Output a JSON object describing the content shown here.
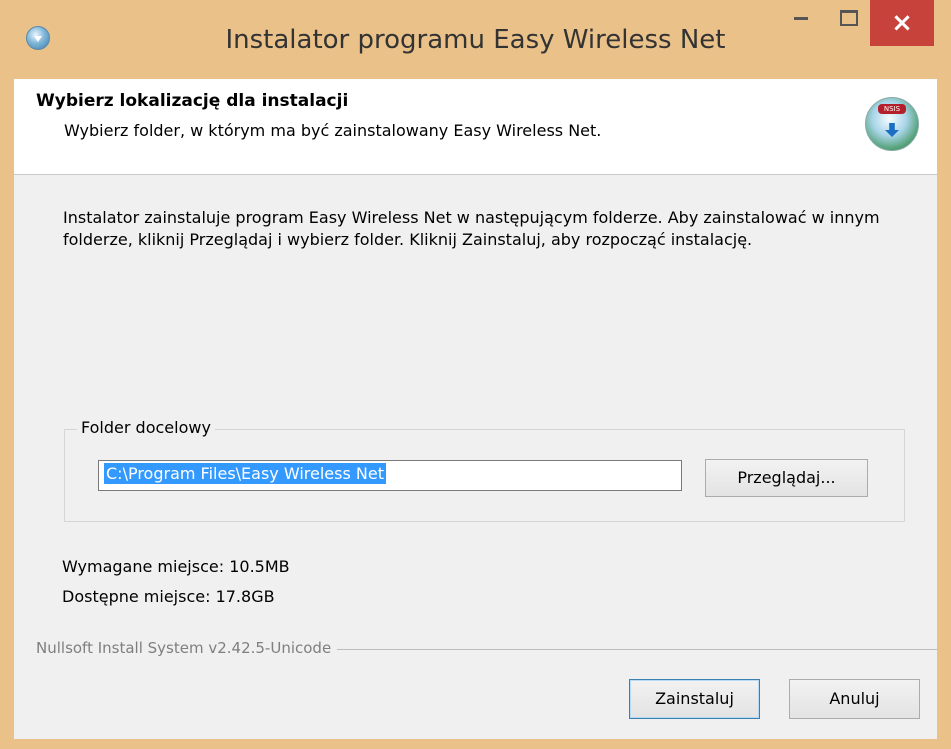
{
  "window": {
    "title": "Instalator programu Easy Wireless Net",
    "close_label": "×"
  },
  "header": {
    "title": "Wybierz lokalizację dla instalacji",
    "subtitle": "Wybierz folder, w którym ma być zainstalowany Easy Wireless Net.",
    "icon_badge": "NSIS"
  },
  "main": {
    "description": "Instalator zainstaluje program Easy Wireless Net w następującym folderze. Aby zainstalować w innym folderze, kliknij Przeglądaj i wybierz folder. Kliknij Zainstaluj, aby rozpocząć instalację.",
    "destination": {
      "group_label": "Folder docelowy",
      "path_value": "C:\\Program Files\\Easy Wireless Net",
      "browse_label": "Przeglądaj..."
    },
    "space_required": "Wymagane miejsce: 10.5MB",
    "space_available": "Dostępne miejsce: 17.8GB"
  },
  "footer": {
    "branding": "Nullsoft Install System v2.42.5-Unicode",
    "install_label": "Zainstaluj",
    "cancel_label": "Anuluj"
  },
  "colors": {
    "titlebar": "#e9c189",
    "close_button": "#c7423b",
    "selection": "#3399ff"
  }
}
